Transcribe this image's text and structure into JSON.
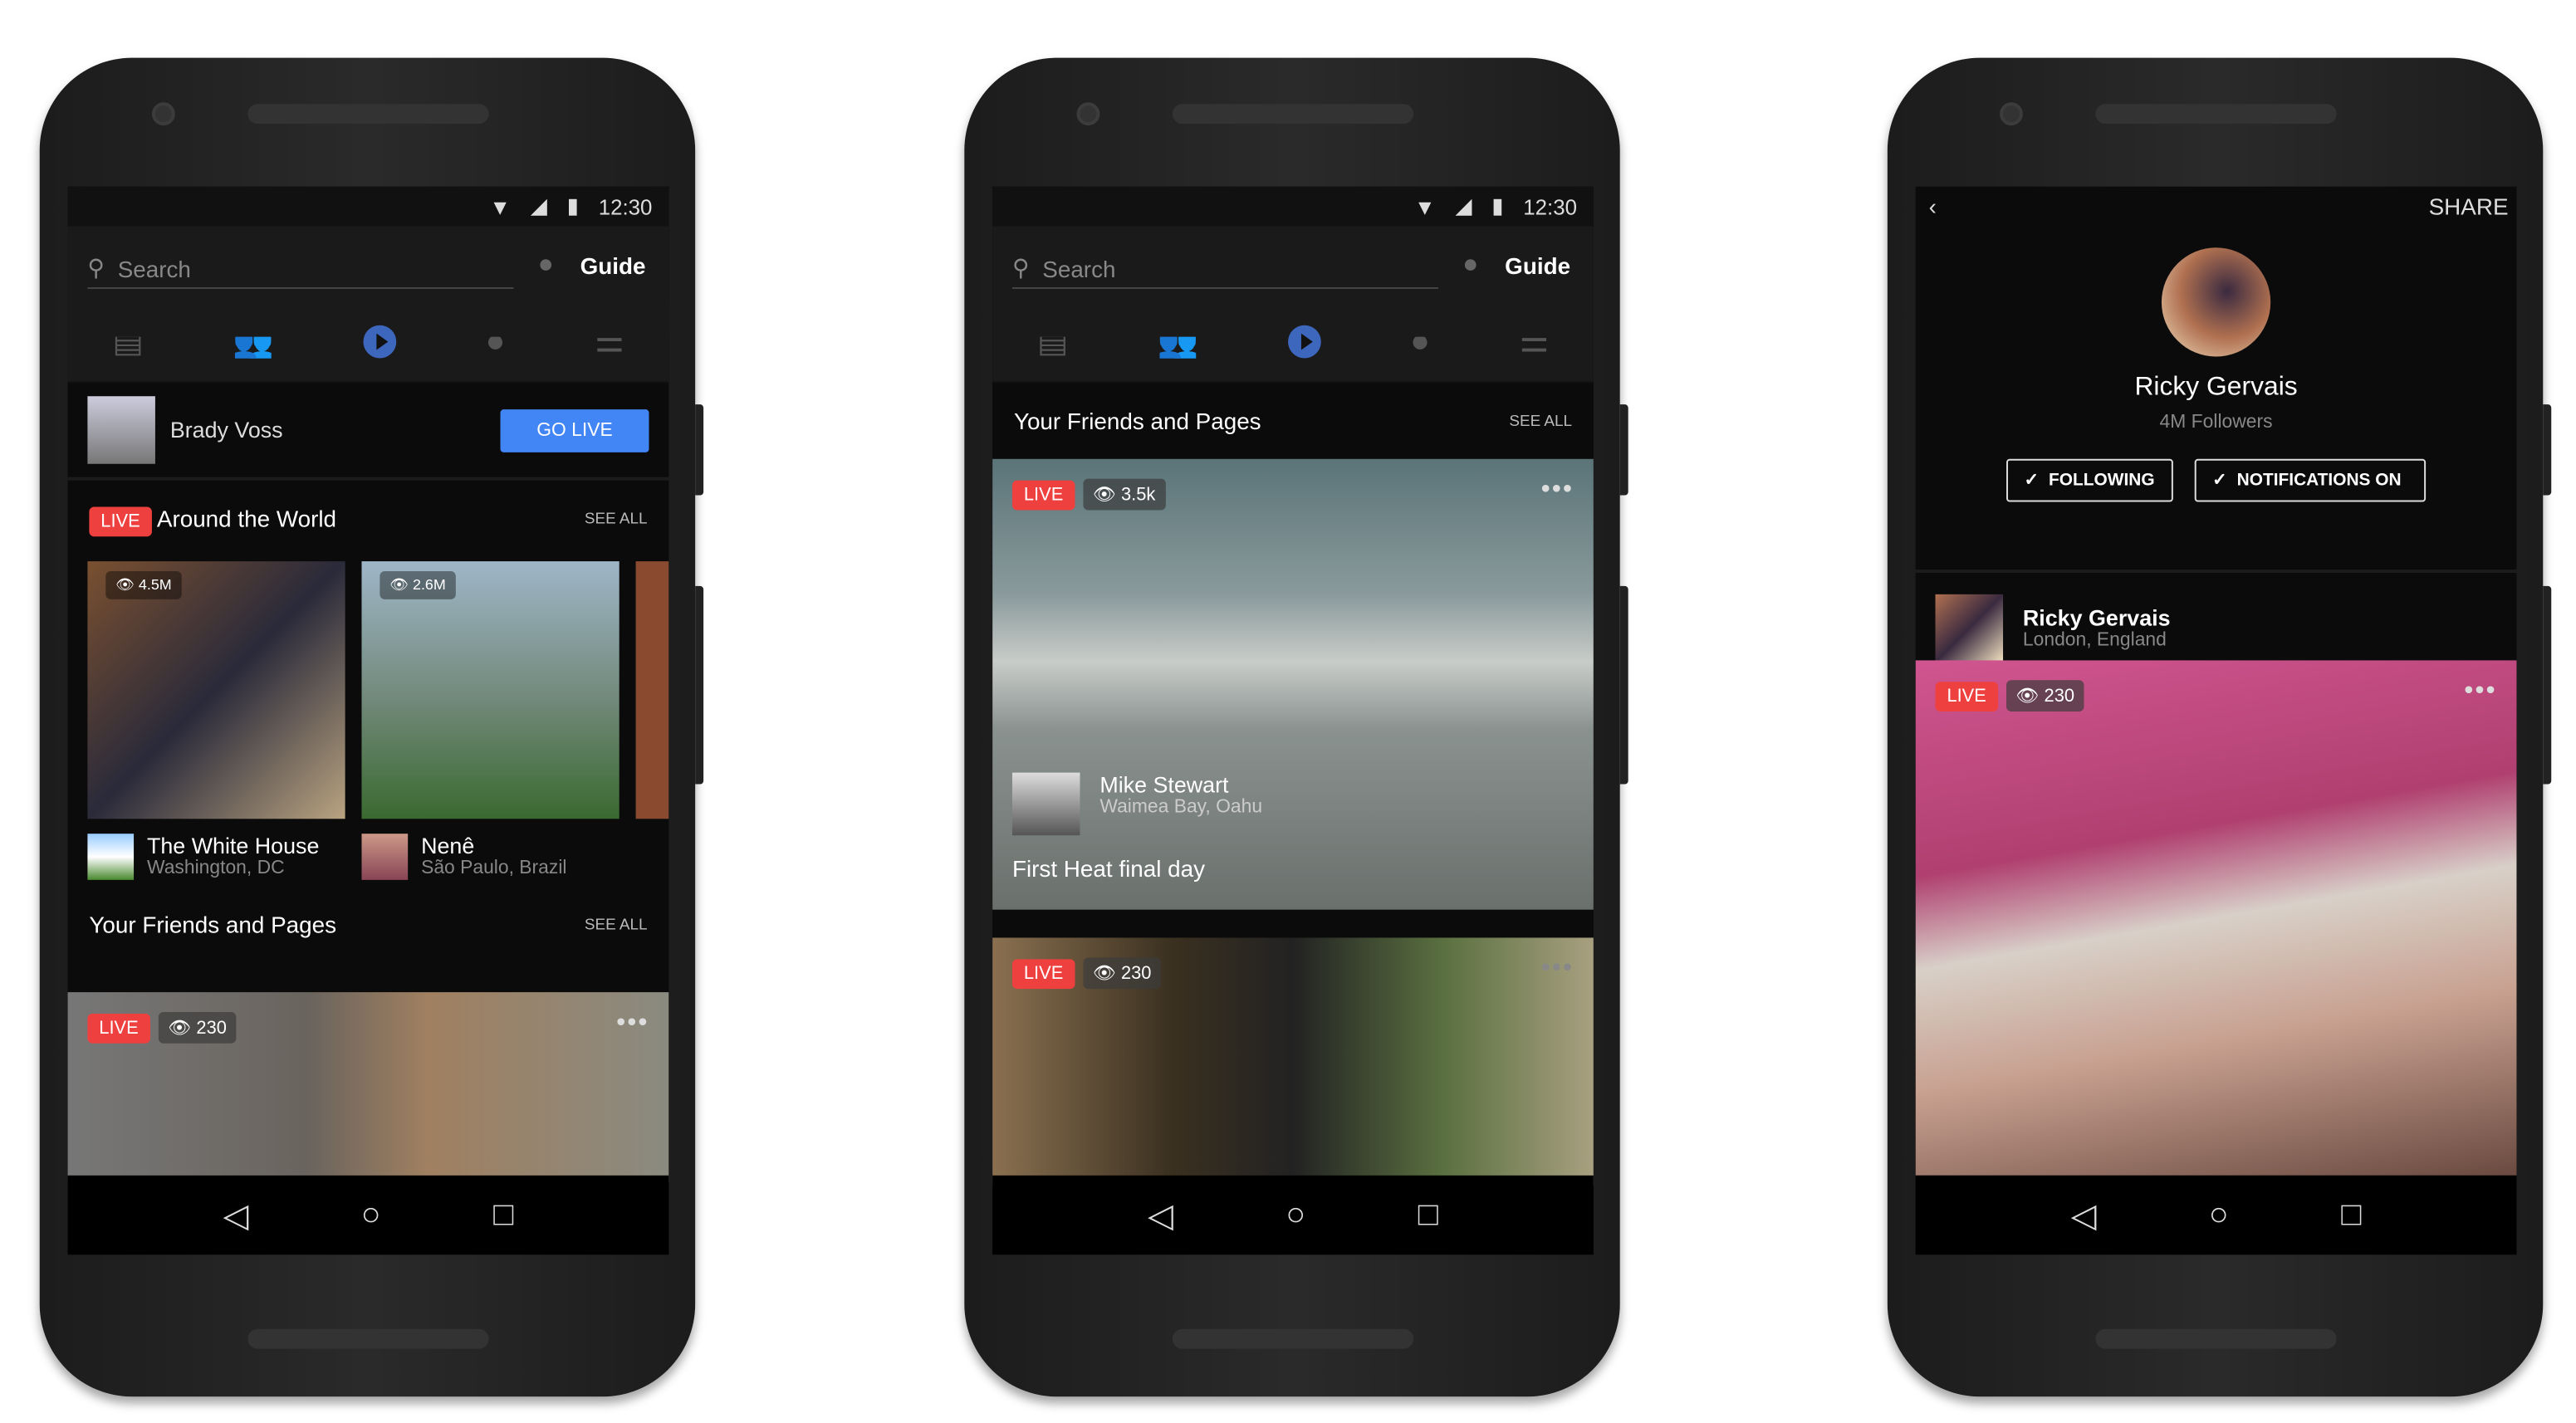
{
  "status": {
    "time": "12:30"
  },
  "colors": {
    "accent": "#3d67bd",
    "go_live": "#4285f4",
    "live": "#ef4040",
    "background": "#0b0b0b"
  },
  "phone1": {
    "search_placeholder": "Search",
    "guide": "Guide",
    "tabs": [
      "news-feed-icon",
      "friends-icon",
      "video-icon",
      "globe-icon",
      "menu-icon"
    ],
    "user": {
      "name": "Brady Voss",
      "go_live": "GO LIVE"
    },
    "around": {
      "badge": "LIVE",
      "title": "Around the World",
      "see_all": "SEE ALL",
      "items": [
        {
          "views": "4.5M",
          "name": "The White House",
          "location": "Washington, DC"
        },
        {
          "views": "2.6M",
          "name": "Nenê",
          "location": "São Paulo, Brazil"
        }
      ]
    },
    "friends": {
      "title": "Your Friends and Pages",
      "see_all": "SEE ALL",
      "live": "LIVE",
      "views": "230"
    }
  },
  "phone2": {
    "search_placeholder": "Search",
    "guide": "Guide",
    "friends": {
      "title": "Your Friends and Pages",
      "see_all": "SEE ALL"
    },
    "video1": {
      "live": "LIVE",
      "views": "3.5k",
      "name": "Mike Stewart",
      "location": "Waimea Bay, Oahu",
      "caption": "First Heat final day"
    },
    "video2": {
      "live": "LIVE",
      "views": "230"
    }
  },
  "phone3": {
    "share": "SHARE",
    "name": "Ricky Gervais",
    "followers": "4M Followers",
    "following": "FOLLOWING",
    "notifications": "NOTIFICATIONS ON",
    "post": {
      "name": "Ricky Gervais",
      "location": "London, England",
      "live": "LIVE",
      "views": "230"
    }
  }
}
